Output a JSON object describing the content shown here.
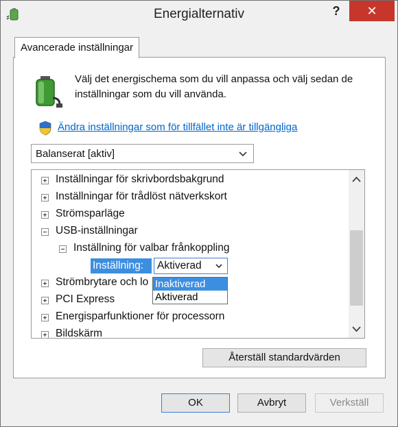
{
  "window": {
    "title": "Energialternativ",
    "help_label": "?",
    "close_label": "✕"
  },
  "tab": {
    "label": "Avancerade inställningar"
  },
  "intro": {
    "text": "Välj det energischema som du vill anpassa och välj sedan de inställningar som du vill använda."
  },
  "link": {
    "label": "Ändra inställningar som för tillfället inte är tillgängliga"
  },
  "plan_select": {
    "value": "Balanserat [aktiv]"
  },
  "tree": {
    "items": [
      {
        "label": "Inställningar för skrivbordsbakgrund",
        "expander": "+"
      },
      {
        "label": "Inställningar för trådlöst nätverkskort",
        "expander": "+"
      },
      {
        "label": "Strömsparläge",
        "expander": "+"
      },
      {
        "label": "USB-inställningar",
        "expander": "−"
      },
      {
        "label": "Inställning för valbar frånkoppling",
        "expander": "−"
      },
      {
        "label": "Strömbrytare och lo",
        "expander": "+"
      },
      {
        "label": "PCI Express",
        "expander": "+"
      },
      {
        "label": "Energisparfunktioner för processorn",
        "expander": "+"
      },
      {
        "label": "Bildskärm",
        "expander": "+"
      }
    ],
    "setting": {
      "label": "Inställning:",
      "value": "Aktiverad",
      "options": [
        "Inaktiverad",
        "Aktiverad"
      ],
      "highlighted_option": "Inaktiverad"
    }
  },
  "buttons": {
    "restore": "Återställ standardvärden",
    "ok": "OK",
    "cancel": "Avbryt",
    "apply": "Verkställ"
  },
  "colors": {
    "close_red": "#c7362b",
    "selection_blue": "#3c8ee0",
    "link_blue": "#0066cc"
  }
}
